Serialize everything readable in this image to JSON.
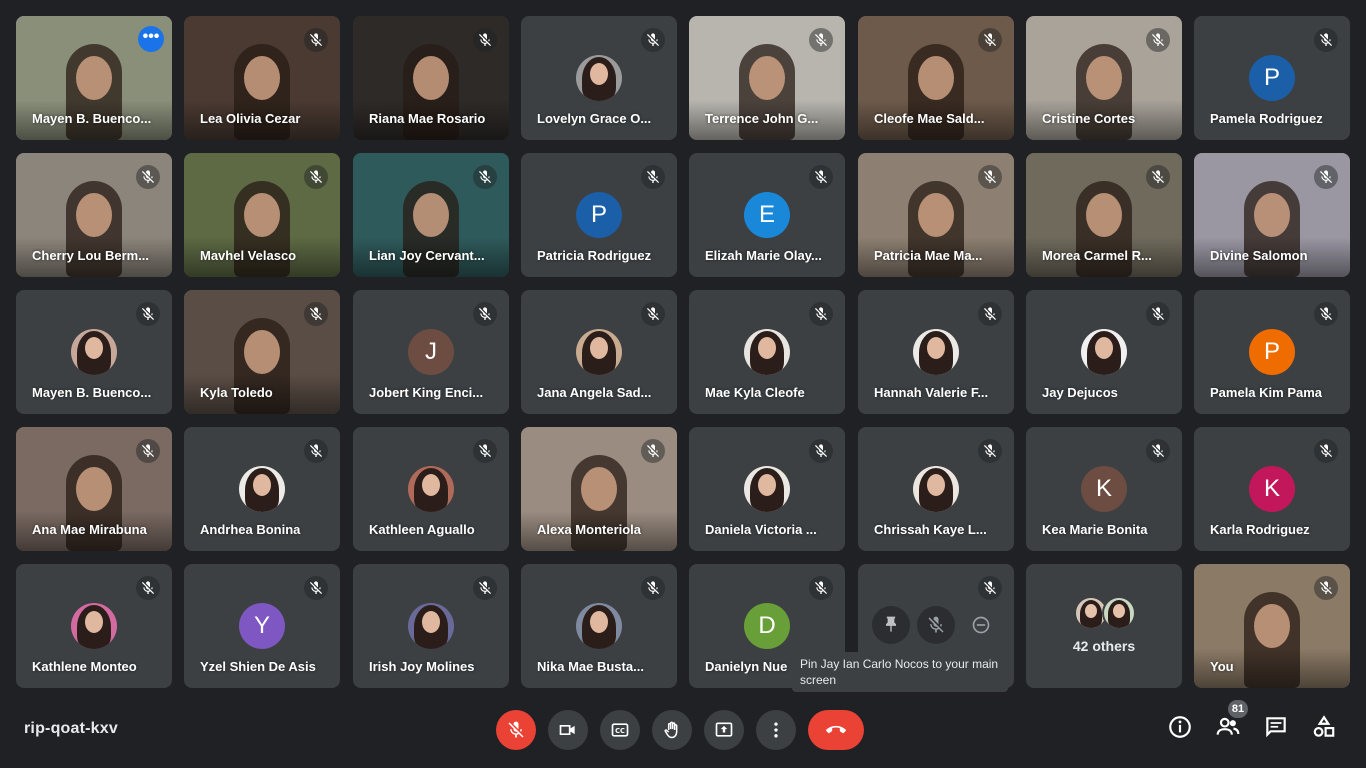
{
  "tiles": [
    {
      "name": "Mayen B. Buenco...",
      "kind": "video",
      "bg": "#8a8f7a",
      "active": true,
      "more": true
    },
    {
      "name": "Lea Olivia Cezar",
      "kind": "video",
      "bg": "#4a3a32"
    },
    {
      "name": "Riana Mae Rosario",
      "kind": "video",
      "bg": "#2e2a28"
    },
    {
      "name": "Lovelyn Grace O...",
      "kind": "photo",
      "bg": "#9b9b9b"
    },
    {
      "name": "Terrence John G...",
      "kind": "video",
      "bg": "#b8b5ae"
    },
    {
      "name": "Cleofe Mae Sald...",
      "kind": "video",
      "bg": "#6d5a4a"
    },
    {
      "name": "Cristine Cortes",
      "kind": "video",
      "bg": "#a9a39a"
    },
    {
      "name": "Pamela Rodriguez",
      "kind": "letter",
      "letter": "P",
      "color": "#1a5fa8"
    },
    {
      "name": "Cherry Lou Berm...",
      "kind": "video",
      "bg": "#8c857c"
    },
    {
      "name": "Mavhel Velasco",
      "kind": "video",
      "bg": "#5d6a44"
    },
    {
      "name": "Lian Joy Cervant...",
      "kind": "video",
      "bg": "#2f5a5b"
    },
    {
      "name": "Patricia Rodriguez",
      "kind": "letter",
      "letter": "P",
      "color": "#1a5fa8"
    },
    {
      "name": "Elizah Marie Olay...",
      "kind": "letter",
      "letter": "E",
      "color": "#1a88d8"
    },
    {
      "name": "Patricia Mae Ma...",
      "kind": "video",
      "bg": "#8d8072"
    },
    {
      "name": "Morea Carmel R...",
      "kind": "video",
      "bg": "#6f6a5c"
    },
    {
      "name": "Divine Salomon",
      "kind": "video",
      "bg": "#9a97a3"
    },
    {
      "name": "Mayen B. Buenco...",
      "kind": "photo",
      "bg": "#c7a79a"
    },
    {
      "name": "Kyla Toledo",
      "kind": "video",
      "bg": "#5a4d45"
    },
    {
      "name": "Jobert King Enci...",
      "kind": "letter",
      "letter": "J",
      "color": "#6d4c41"
    },
    {
      "name": "Jana Angela Sad...",
      "kind": "photo",
      "bg": "#c9ab8f"
    },
    {
      "name": "Mae Kyla Cleofe",
      "kind": "photo",
      "bg": "#e8e4e0"
    },
    {
      "name": "Hannah Valerie F...",
      "kind": "photo",
      "bg": "#eceae6"
    },
    {
      "name": "Jay Dejucos",
      "kind": "photo",
      "bg": "#f0f0f0"
    },
    {
      "name": "Pamela Kim Pama",
      "kind": "letter",
      "letter": "P",
      "color": "#ef6c00"
    },
    {
      "name": "Ana Mae Mirabuna",
      "kind": "video",
      "bg": "#7a6a62"
    },
    {
      "name": "Andrhea Bonina",
      "kind": "photo",
      "bg": "#ecebe8"
    },
    {
      "name": "Kathleen Aguallo",
      "kind": "photo",
      "bg": "#b06a5a"
    },
    {
      "name": "Alexa Monteriola",
      "kind": "video",
      "bg": "#9a8c80"
    },
    {
      "name": "Daniela Victoria ...",
      "kind": "photo",
      "bg": "#ebe7e2"
    },
    {
      "name": "Chrissah Kaye L...",
      "kind": "photo",
      "bg": "#ece6df"
    },
    {
      "name": "Kea Marie Bonita",
      "kind": "letter",
      "letter": "K",
      "color": "#6d4c41"
    },
    {
      "name": "Karla Rodriguez",
      "kind": "letter",
      "letter": "K",
      "color": "#c2185b"
    },
    {
      "name": "Kathlene Monteo",
      "kind": "photo",
      "bg": "#d36aa0"
    },
    {
      "name": "Yzel Shien De Asis",
      "kind": "letter",
      "letter": "Y",
      "color": "#7e57c2"
    },
    {
      "name": "Irish Joy Molines",
      "kind": "photo",
      "bg": "#6a6a9a"
    },
    {
      "name": "Nika Mae Busta...",
      "kind": "photo",
      "bg": "#7f8aa0"
    },
    {
      "name": "Danielyn Nue",
      "kind": "letter",
      "letter": "D",
      "color": "#689f38"
    },
    {
      "name": "",
      "kind": "hover"
    },
    {
      "name": "",
      "kind": "others"
    },
    {
      "name": "You",
      "kind": "video",
      "bg": "#8b7a66"
    }
  ],
  "others": {
    "label": "42 others"
  },
  "tooltip": {
    "text": "Pin Jay Ian Carlo Nocos to your main screen"
  },
  "meeting": {
    "code": "rip-qoat-kxv"
  },
  "people_count": "81",
  "colors": {
    "background": "#202124",
    "tile": "#3c4043",
    "end_call": "#ea4335",
    "accent": "#8ab4f8"
  },
  "icons": [
    "mic-off-icon",
    "camera-icon",
    "captions-icon",
    "raise-hand-icon",
    "present-icon",
    "more-options-icon",
    "end-call-icon",
    "info-icon",
    "people-icon",
    "chat-icon",
    "activities-icon",
    "pin-icon",
    "minus-circle-icon"
  ]
}
